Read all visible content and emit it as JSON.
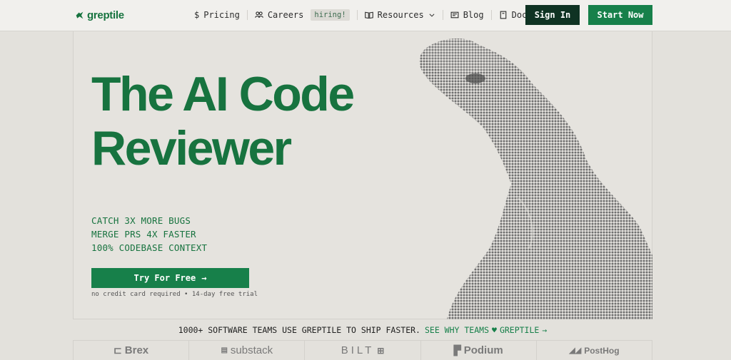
{
  "nav": {
    "brand": "greptile",
    "items": [
      {
        "label": "Pricing",
        "icon": "dollar-icon"
      },
      {
        "label": "Careers",
        "icon": "people-icon",
        "badge": "hiring!"
      },
      {
        "label": "Resources",
        "icon": "book-icon"
      },
      {
        "label": "Blog",
        "icon": "newspaper-icon"
      },
      {
        "label": "Docs",
        "icon": "document-icon"
      }
    ],
    "signin_label": "Sign In",
    "start_label": "Start Now"
  },
  "hero": {
    "headline_line1": "The AI Code",
    "headline_line2": "Reviewer",
    "features": [
      "CATCH 3X MORE BUGS",
      "MERGE PRS 4X FASTER",
      "100% CODEBASE CONTEXT"
    ],
    "cta_label": "Try For Free",
    "cta_note": "no credit card required • 14-day free trial"
  },
  "teams": {
    "text": "1000+ SOFTWARE TEAMS USE GREPTILE TO SHIP FASTER.",
    "link_prefix": "SEE WHY TEAMS",
    "link_suffix": "GREPTILE"
  },
  "customers": [
    "Brex",
    "substack",
    "BILT",
    "Podium",
    "PostHog"
  ],
  "colors": {
    "brand": "#17733f",
    "button": "#17804a",
    "dark": "#0f3323",
    "bg": "#e3e1dc"
  }
}
